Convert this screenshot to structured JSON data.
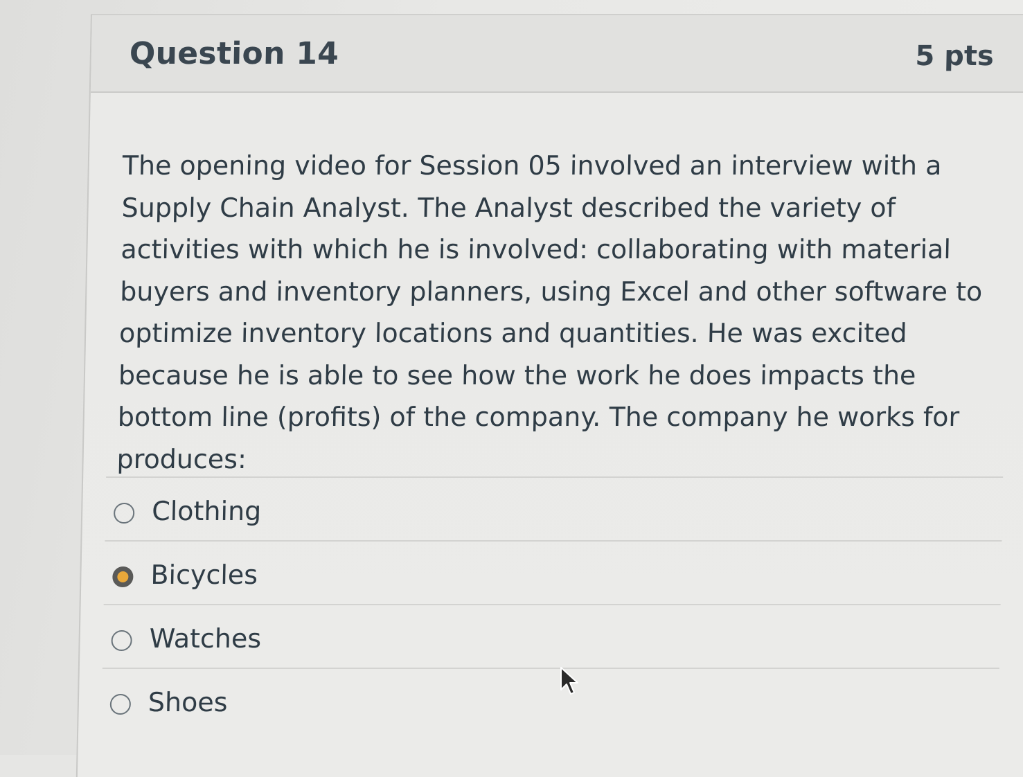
{
  "question": {
    "title": "Question 14",
    "points": "5 pts",
    "text": "The opening video for Session 05 involved an interview with a Supply Chain Analyst. The Analyst described the variety of activities with which he is involved: collaborating with material buyers and inventory planners, using Excel and other software to optimize inventory locations and quantities. He was excited because he is able to see how the work he does impacts the bottom line (profits) of the company. The company he works for produces:"
  },
  "answers": [
    {
      "label": "Clothing",
      "selected": false
    },
    {
      "label": "Bicycles",
      "selected": true
    },
    {
      "label": "Watches",
      "selected": false
    },
    {
      "label": "Shoes",
      "selected": false
    }
  ],
  "colors": {
    "selected_radio": "#e9a83a",
    "text": "#2f3c46"
  },
  "icons": {
    "cursor": "mouse-pointer-icon",
    "radio": "radio-button-icon"
  }
}
